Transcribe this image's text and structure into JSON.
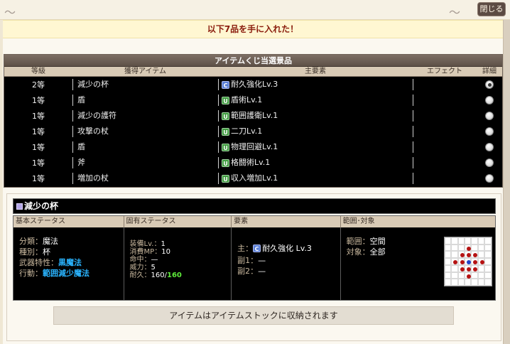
{
  "window": {
    "close_label": "閉じる",
    "notice": "以下7品を手に入れた！"
  },
  "prize_table": {
    "title": "アイテムくじ当選景品",
    "headers": {
      "rank": "等級",
      "item": "獲得アイテム",
      "element": "主要素",
      "effect": "エフェクト",
      "detail": "詳細"
    },
    "rows": [
      {
        "rank": "2等",
        "item": "減少の杯",
        "badge": "C",
        "element": "耐久強化Lv.3",
        "effect": "",
        "selected": true
      },
      {
        "rank": "1等",
        "item": "盾",
        "badge": "U",
        "element": "盾術Lv.1",
        "effect": "",
        "selected": false
      },
      {
        "rank": "1等",
        "item": "減少の護符",
        "badge": "U",
        "element": "範囲護衛Lv.1",
        "effect": "",
        "selected": false
      },
      {
        "rank": "1等",
        "item": "攻撃の杖",
        "badge": "U",
        "element": "二刀Lv.1",
        "effect": "",
        "selected": false
      },
      {
        "rank": "1等",
        "item": "盾",
        "badge": "U",
        "element": "物理回避Lv.1",
        "effect": "",
        "selected": false
      },
      {
        "rank": "1等",
        "item": "斧",
        "badge": "U",
        "element": "格闘術Lv.1",
        "effect": "",
        "selected": false
      },
      {
        "rank": "1等",
        "item": "増加の杖",
        "badge": "U",
        "element": "収入増加Lv.1",
        "effect": "",
        "selected": false
      }
    ]
  },
  "detail": {
    "title": "減少の杯",
    "headers": {
      "basic": "基本ステータス",
      "unique": "固有ステータス",
      "elements": "要素",
      "range": "範囲･対象"
    },
    "basic": {
      "category_label": "分類：",
      "category_value": "魔法",
      "type_label": "種別：",
      "type_value": "杯",
      "weapon_trait_label": "武器特性：",
      "weapon_trait_value": "黒魔法",
      "action_label": "行動：",
      "action_value": "範囲減少魔法"
    },
    "unique": {
      "equip_lv_label": "装備Lv.：",
      "equip_lv_value": "1",
      "mp_label": "消費MP：",
      "mp_value": "10",
      "accuracy_label": "命中：",
      "accuracy_value": "—",
      "power_label": "威力：",
      "power_value": "5",
      "durability_label": "耐久：",
      "durability_current": "160/",
      "durability_max": "160"
    },
    "elements": {
      "main_label": "主：",
      "main_badge": "C",
      "main_value": "耐久強化 Lv.3",
      "sub1_label": "副1：",
      "sub1_value": "—",
      "sub2_label": "副2：",
      "sub2_value": "—"
    },
    "range": {
      "range_label": "範囲：",
      "range_value": "空間",
      "target_label": "対象：",
      "target_value": "全部"
    },
    "area_grid": [
      "0000000",
      "000R000",
      "00RRR00",
      "0RRBRR0",
      "00RRR00",
      "000R000",
      "0000000"
    ]
  },
  "footer": {
    "message": "アイテムはアイテムストックに収納されます"
  },
  "colors": {
    "accent_blue": "#2ab4ff",
    "accent_green": "#5eea3a",
    "notice_red": "#8a1c0c"
  }
}
